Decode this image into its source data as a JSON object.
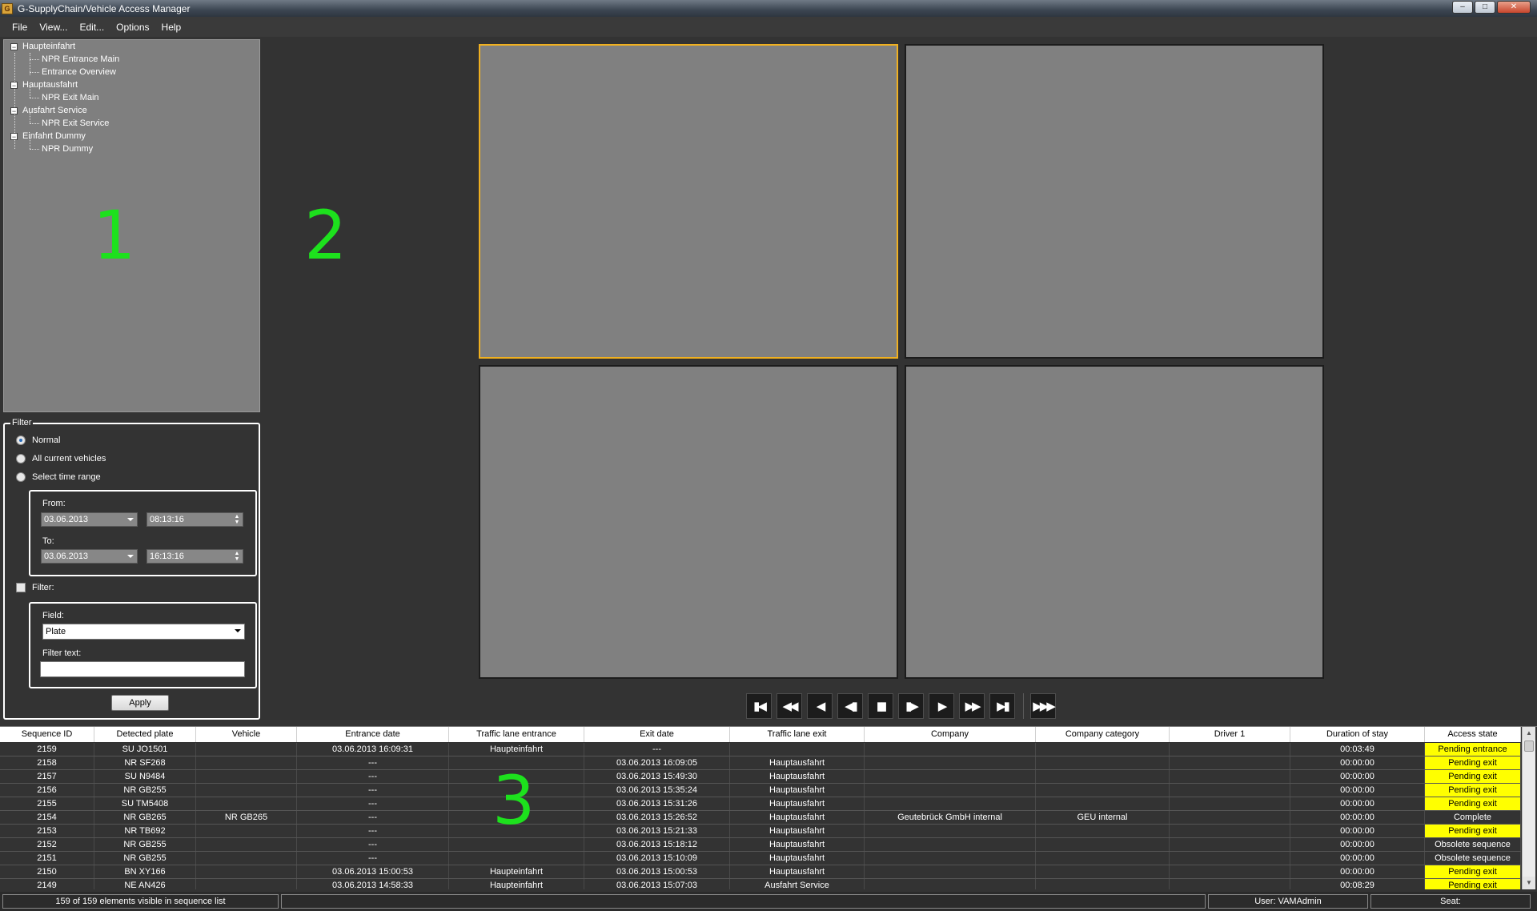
{
  "window": {
    "title": "G-SupplyChain/Vehicle Access Manager",
    "icon": "app-icon",
    "minimize": "–",
    "maximize": "□",
    "close": "✕"
  },
  "menu": [
    "File",
    "View...",
    "Edit...",
    "Options",
    "Help"
  ],
  "tree": [
    {
      "label": "Haupteinfahrt",
      "children": [
        "NPR Entrance Main",
        "Entrance Overview"
      ]
    },
    {
      "label": "Hauptausfahrt",
      "children": [
        "NPR Exit Main"
      ]
    },
    {
      "label": "Ausfahrt Service",
      "children": [
        "NPR Exit Service"
      ]
    },
    {
      "label": "Einfahrt Dummy",
      "children": [
        "NPR Dummy"
      ]
    }
  ],
  "annotations": [
    "1",
    "2",
    "3"
  ],
  "filter": {
    "legend": "Filter",
    "radio_normal": "Normal",
    "radio_all": "All current vehicles",
    "radio_range": "Select time range",
    "selected": "Normal",
    "from_label": "From:",
    "to_label": "To:",
    "from_date": "03.06.2013",
    "from_time": "08:13:16",
    "to_date": "03.06.2013",
    "to_time": "16:13:16",
    "filter_checkbox": "Filter:",
    "filter_checked": false,
    "field_label": "Field:",
    "field_value": "Plate",
    "filter_text_label": "Filter text:",
    "filter_text_value": "",
    "apply": "Apply"
  },
  "controls": [
    "first-icon",
    "fast-rewind-icon",
    "step-back-icon",
    "frame-back-icon",
    "pause-icon",
    "frame-forward-icon",
    "play-icon",
    "fast-forward-icon",
    "last-icon",
    "live-icon"
  ],
  "table": {
    "columns": [
      "Sequence ID",
      "Detected plate",
      "Vehicle",
      "Entrance date",
      "Traffic lane entrance",
      "Exit date",
      "Traffic lane exit",
      "Company",
      "Company category",
      "Driver 1",
      "Duration of stay",
      "Access state"
    ],
    "rows": [
      [
        "2159",
        "SU JO1501",
        "",
        "03.06.2013 16:09:31",
        "Haupteinfahrt",
        "---",
        "",
        "",
        "",
        "",
        "00:03:49",
        "Pending entrance"
      ],
      [
        "2158",
        "NR SF268",
        "",
        "---",
        "",
        "03.06.2013 16:09:05",
        "Hauptausfahrt",
        "",
        "",
        "",
        "00:00:00",
        "Pending exit"
      ],
      [
        "2157",
        "SU N9484",
        "",
        "---",
        "",
        "03.06.2013 15:49:30",
        "Hauptausfahrt",
        "",
        "",
        "",
        "00:00:00",
        "Pending exit"
      ],
      [
        "2156",
        "NR GB255",
        "",
        "---",
        "",
        "03.06.2013 15:35:24",
        "Hauptausfahrt",
        "",
        "",
        "",
        "00:00:00",
        "Pending exit"
      ],
      [
        "2155",
        "SU TM5408",
        "",
        "---",
        "",
        "03.06.2013 15:31:26",
        "Hauptausfahrt",
        "",
        "",
        "",
        "00:00:00",
        "Pending exit"
      ],
      [
        "2154",
        "NR GB265",
        "NR GB265",
        "---",
        "",
        "03.06.2013 15:26:52",
        "Hauptausfahrt",
        "Geutebrück GmbH internal",
        "GEU internal",
        "",
        "00:00:00",
        "Complete"
      ],
      [
        "2153",
        "NR TB692",
        "",
        "---",
        "",
        "03.06.2013 15:21:33",
        "Hauptausfahrt",
        "",
        "",
        "",
        "00:00:00",
        "Pending exit"
      ],
      [
        "2152",
        "NR GB255",
        "",
        "---",
        "",
        "03.06.2013 15:18:12",
        "Hauptausfahrt",
        "",
        "",
        "",
        "00:00:00",
        "Obsolete sequence"
      ],
      [
        "2151",
        "NR GB255",
        "",
        "---",
        "",
        "03.06.2013 15:10:09",
        "Hauptausfahrt",
        "",
        "",
        "",
        "00:00:00",
        "Obsolete sequence"
      ],
      [
        "2150",
        "BN XY166",
        "",
        "03.06.2013 15:00:53",
        "Haupteinfahrt",
        "03.06.2013 15:00:53",
        "Hauptausfahrt",
        "",
        "",
        "",
        "00:00:00",
        "Pending exit"
      ],
      [
        "2149",
        "NE AN426",
        "",
        "03.06.2013 14:58:33",
        "Haupteinfahrt",
        "03.06.2013 15:07:03",
        "Ausfahrt Service",
        "",
        "",
        "",
        "00:08:29",
        "Pending exit"
      ]
    ],
    "highlight_states": [
      "Pending entrance",
      "Pending exit"
    ],
    "highlight_color": "#ffff00"
  },
  "status": {
    "count": "159 of 159 elements visible in sequence list",
    "user": "User: VAMAdmin",
    "seat": "Seat:"
  },
  "colors": {
    "active_tile": "#f0b020",
    "tile": "#808080",
    "annotation": "#1de11d"
  }
}
